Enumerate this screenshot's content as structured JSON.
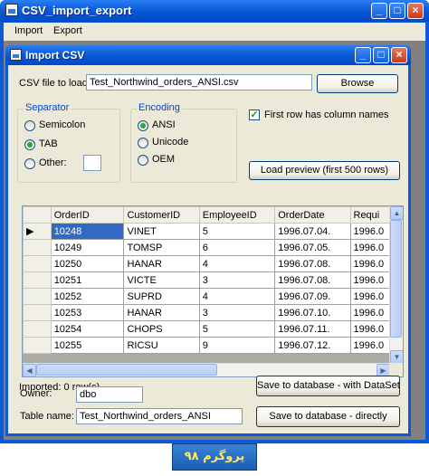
{
  "app": {
    "title": "CSV_import_export",
    "menu": [
      "Import",
      "Export"
    ]
  },
  "dialog": {
    "title": "Import CSV",
    "csv_file_label": "CSV file to load:",
    "csv_file_value": "Test_Northwind_orders_ANSI.csv",
    "browse_label": "Browse",
    "separator": {
      "title": "Separator",
      "options": [
        "Semicolon",
        "TAB",
        "Other:"
      ],
      "selected": "TAB",
      "other_value": ""
    },
    "encoding": {
      "title": "Encoding",
      "options": [
        "ANSI",
        "Unicode",
        "OEM"
      ],
      "selected": "ANSI"
    },
    "first_row_header_label": "First row has column names",
    "first_row_header_checked": true,
    "load_preview_label": "Load preview (first 500 rows)",
    "grid": {
      "columns": [
        "OrderID",
        "CustomerID",
        "EmployeeID",
        "OrderDate",
        "Requi"
      ],
      "rows": [
        [
          "10248",
          "VINET",
          "5",
          "1996.07.04.",
          "1996.0"
        ],
        [
          "10249",
          "TOMSP",
          "6",
          "1996.07.05.",
          "1996.0"
        ],
        [
          "10250",
          "HANAR",
          "4",
          "1996.07.08.",
          "1996.0"
        ],
        [
          "10251",
          "VICTE",
          "3",
          "1996.07.08.",
          "1996.0"
        ],
        [
          "10252",
          "SUPRD",
          "4",
          "1996.07.09.",
          "1996.0"
        ],
        [
          "10253",
          "HANAR",
          "3",
          "1996.07.10.",
          "1996.0"
        ],
        [
          "10254",
          "CHOPS",
          "5",
          "1996.07.11.",
          "1996.0"
        ],
        [
          "10255",
          "RICSU",
          "9",
          "1996.07.12.",
          "1996.0"
        ]
      ]
    },
    "imported_label": "Imported: 0 row(s)",
    "owner_label": "Owner:",
    "owner_value": "dbo",
    "table_name_label": "Table name:",
    "table_name_value": "Test_Northwind_orders_ANSI",
    "save_dataset_label": "Save to database - with DataSet",
    "save_direct_label": "Save to database - directly"
  },
  "brand_text": "پروگرم ۹۸",
  "colors": {
    "titlebar": "#0a58d6",
    "window_bg": "#ece9d8",
    "selection": "#316ac5",
    "group_title": "#0046d5"
  }
}
